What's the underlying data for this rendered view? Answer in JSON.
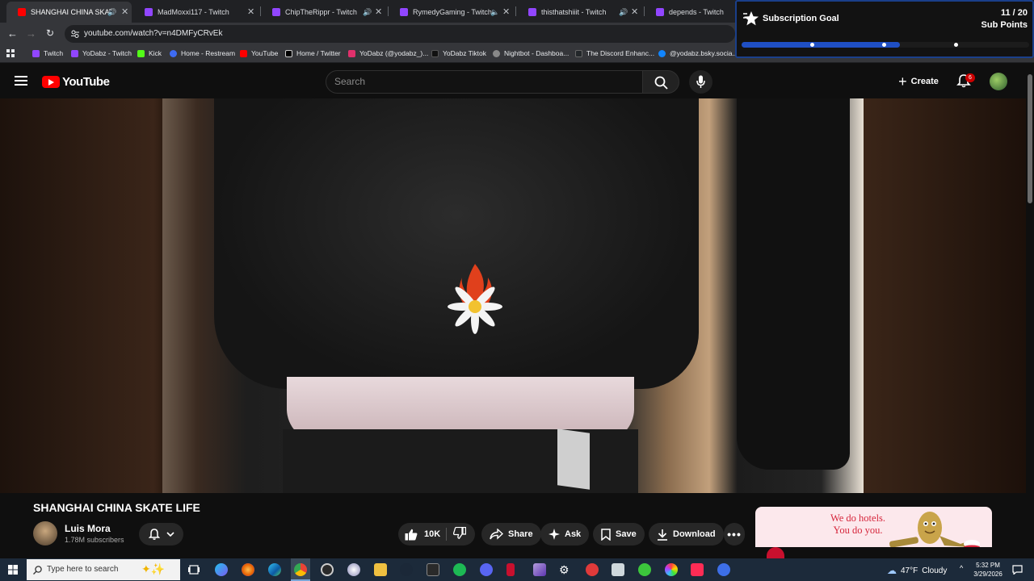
{
  "browser": {
    "tabs": [
      {
        "title": "SHANGHAI CHINA SKATE LIFE",
        "icon": "youtube-favicon",
        "audio": true,
        "active": true
      },
      {
        "title": "MadMoxxi117 - Twitch",
        "icon": "twitch-favicon",
        "audio": false
      },
      {
        "title": "ChipTheRippr - Twitch",
        "icon": "twitch-favicon",
        "audio": true
      },
      {
        "title": "RymedyGaming - Twitch",
        "icon": "twitch-favicon",
        "audio": true
      },
      {
        "title": "thisthatshiiit - Twitch",
        "icon": "twitch-favicon",
        "audio": true
      },
      {
        "title": "depends - Twitch",
        "icon": "twitch-favicon",
        "audio": false
      }
    ],
    "url": "youtube.com/watch?v=n4DMFyCRvEk",
    "bookmarks": [
      {
        "label": "Twitch",
        "color": "#9146ff"
      },
      {
        "label": "YoDabz - Twitch",
        "color": "#9146ff"
      },
      {
        "label": "Kick",
        "color": "#53fc18"
      },
      {
        "label": "Home - Restream",
        "color": "#3e6bf3"
      },
      {
        "label": "YouTube",
        "color": "#ff0000"
      },
      {
        "label": "Home / Twitter",
        "color": "#000000"
      },
      {
        "label": "YoDabz (@yodabz_)...",
        "color": "#e1306c"
      },
      {
        "label": "YoDabz Tiktok",
        "color": "#111111"
      },
      {
        "label": "Nightbot - Dashboa...",
        "color": "#888888"
      },
      {
        "label": "The Discord Enhanc...",
        "color": "#23272a"
      },
      {
        "label": "@yodabz.bsky.socia...",
        "color": "#1185fe"
      }
    ]
  },
  "subscription_goal": {
    "title": "Subscription Goal",
    "count": "11 / 20",
    "label": "Sub Points",
    "progress": 0.55,
    "accent": "#1f4fc4"
  },
  "youtube": {
    "logo_text": "YouTube",
    "search_placeholder": "Search",
    "create_label": "Create",
    "notification_count": "6"
  },
  "video": {
    "title": "SHANGHAI CHINA SKATE LIFE",
    "channel": "Luis Mora",
    "subscribers": "1.78M subscribers",
    "likes": "10K",
    "share_label": "Share",
    "ask_label": "Ask",
    "save_label": "Save",
    "download_label": "Download"
  },
  "ad": {
    "line1": "We do hotels.",
    "line2": "You do you.",
    "brand_color": "#d6263c"
  },
  "taskbar": {
    "search_placeholder": "Type here to search",
    "weather_temp": "47°F",
    "weather_cond": "Cloudy",
    "time": "5:32 PM",
    "date": "3/29/2026"
  }
}
